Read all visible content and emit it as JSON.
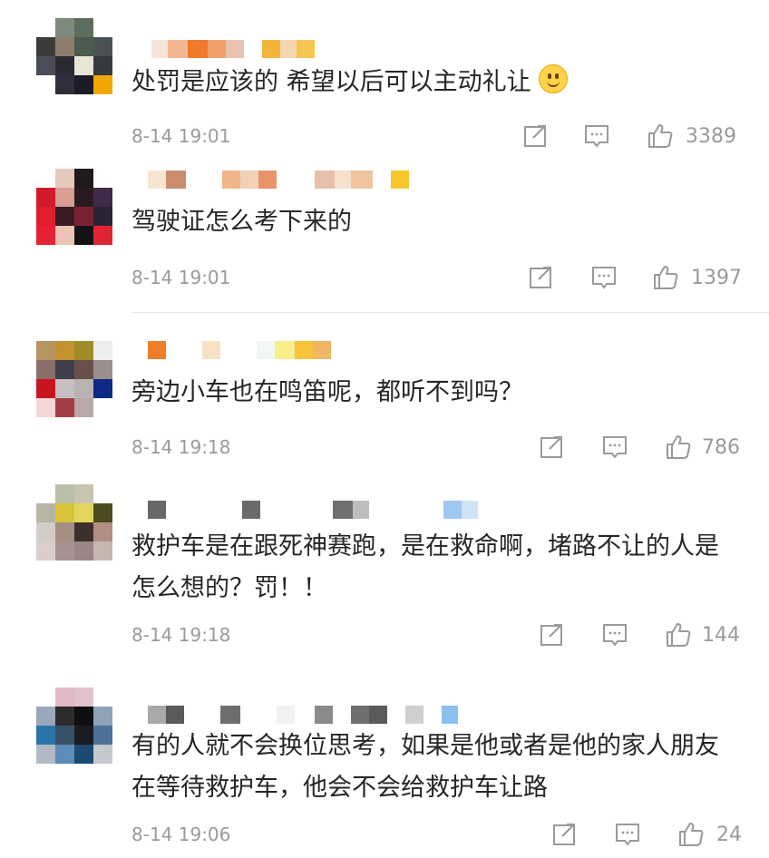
{
  "comments": [
    {
      "text": "处罚是应该的  希望以后可以主动礼让",
      "time": "8-14 19:01",
      "likes": "3389",
      "emoji": "smile-emoji"
    },
    {
      "text": "驾驶证怎么考下来的",
      "time": "8-14 19:01",
      "likes": "1397"
    },
    {
      "text": "旁边小车也在鸣笛呢，都听不到吗？",
      "time": "8-14 19:18",
      "likes": "786"
    },
    {
      "text": "救护车是在跟死神赛跑，是在救命啊，堵路不让的人是怎么想的？罚！！",
      "time": "8-14 19:18",
      "likes": "144"
    },
    {
      "text": "有的人就不会换位思考，如果是他或者是他的家人朋友在等待救护车，他会不会给救护车让路",
      "time": "8-14 19:06",
      "likes": "24"
    }
  ],
  "icons": {
    "share": "share-icon",
    "comment": "comment-icon",
    "like": "thumbs-up-icon"
  }
}
